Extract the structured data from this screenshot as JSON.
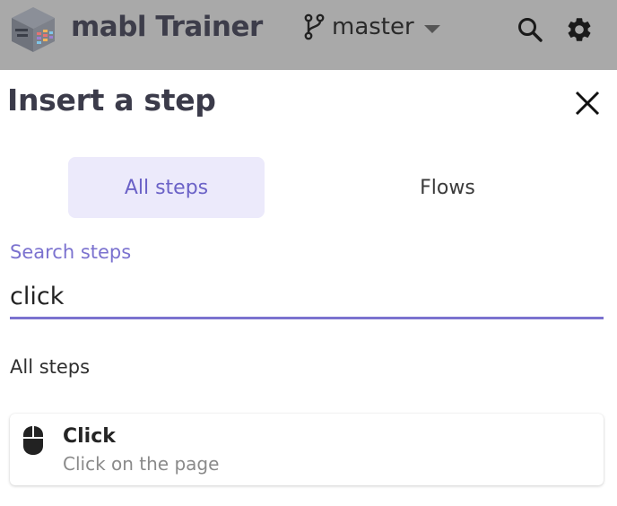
{
  "app": {
    "title": "mabl Trainer",
    "branch": "master"
  },
  "panel": {
    "title": "Insert a step"
  },
  "tabs": [
    {
      "label": "All steps",
      "active": true
    },
    {
      "label": "Flows",
      "active": false
    }
  ],
  "search": {
    "label": "Search steps",
    "value": "click"
  },
  "results": {
    "heading": "All steps",
    "items": [
      {
        "name": "Click",
        "description": "Click on the page",
        "icon": "mouse-icon"
      }
    ]
  },
  "colors": {
    "topbar": "#a9a9a9",
    "accent": "#7b72cf",
    "active_tab_bg": "#eceafb"
  }
}
